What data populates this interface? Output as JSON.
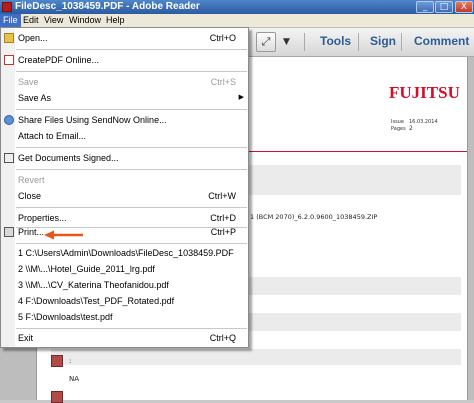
{
  "window": {
    "title": "FileDesc_1038459.PDF - Adobe Reader",
    "controls": {
      "minimize": "_",
      "maximize": "□",
      "close": "X"
    }
  },
  "menubar": {
    "items": [
      "File",
      "Edit",
      "View",
      "Window",
      "Help"
    ],
    "active": "File"
  },
  "toolbar": {
    "links": [
      "Tools",
      "Sign",
      "Comment"
    ]
  },
  "file_menu": {
    "items": [
      {
        "label": "Open...",
        "shortcut": "Ctrl+O",
        "icon": "folder-icon",
        "enabled": true
      },
      {
        "label": "CreatePDF Online...",
        "shortcut": "",
        "icon": "createpdf-icon",
        "enabled": true
      },
      {
        "label": "Save",
        "shortcut": "Ctrl+S",
        "icon": "",
        "enabled": false
      },
      {
        "label": "Save As",
        "shortcut": "",
        "icon": "",
        "enabled": true,
        "submenu": true
      },
      {
        "label": "Share Files Using SendNow Online...",
        "shortcut": "",
        "icon": "share-icon",
        "enabled": true
      },
      {
        "label": "Attach to Email...",
        "shortcut": "",
        "icon": "",
        "enabled": true
      },
      {
        "label": "Get Documents Signed...",
        "shortcut": "",
        "icon": "sign-icon",
        "enabled": true
      },
      {
        "label": "Revert",
        "shortcut": "",
        "icon": "",
        "enabled": false
      },
      {
        "label": "Close",
        "shortcut": "Ctrl+W",
        "icon": "",
        "enabled": true
      },
      {
        "label": "Properties...",
        "shortcut": "Ctrl+D",
        "icon": "",
        "enabled": true
      },
      {
        "label": "Print...",
        "shortcut": "Ctrl+P",
        "icon": "printer-icon",
        "enabled": true
      },
      {
        "label": "1 C:\\Users\\Admin\\Downloads\\FileDesc_1038459.PDF",
        "shortcut": "",
        "icon": "",
        "enabled": true
      },
      {
        "label": "2 \\\\M\\...\\Hotel_Guide_2011_lrg.pdf",
        "shortcut": "",
        "icon": "",
        "enabled": true
      },
      {
        "label": "3 \\\\M\\...\\CV_Katerina Theofanidou.pdf",
        "shortcut": "",
        "icon": "",
        "enabled": true
      },
      {
        "label": "4 F:\\Downloads\\Test_PDF_Rotated.pdf",
        "shortcut": "",
        "icon": "",
        "enabled": true
      },
      {
        "label": "5 F:\\Downloads\\test.pdf",
        "shortcut": "",
        "icon": "",
        "enabled": true
      },
      {
        "label": "Exit",
        "shortcut": "Ctrl+Q",
        "icon": "",
        "enabled": true
      }
    ]
  },
  "document": {
    "logo": "FUJITSU",
    "meta": {
      "issue_label": "Issue",
      "issue_value": "16.03.2014",
      "pages_label": "Pages",
      "pages_value": "2"
    },
    "file_line": "1 (BCM 2070)_6.2.0.9600_1038459.ZIP",
    "colon": ":",
    "na": "NA"
  },
  "colors": {
    "accent_red": "#d0102b",
    "menu_highlight": "#3d6fc7",
    "link_blue": "#2c5d95",
    "arrow_orange": "#e8561a"
  }
}
